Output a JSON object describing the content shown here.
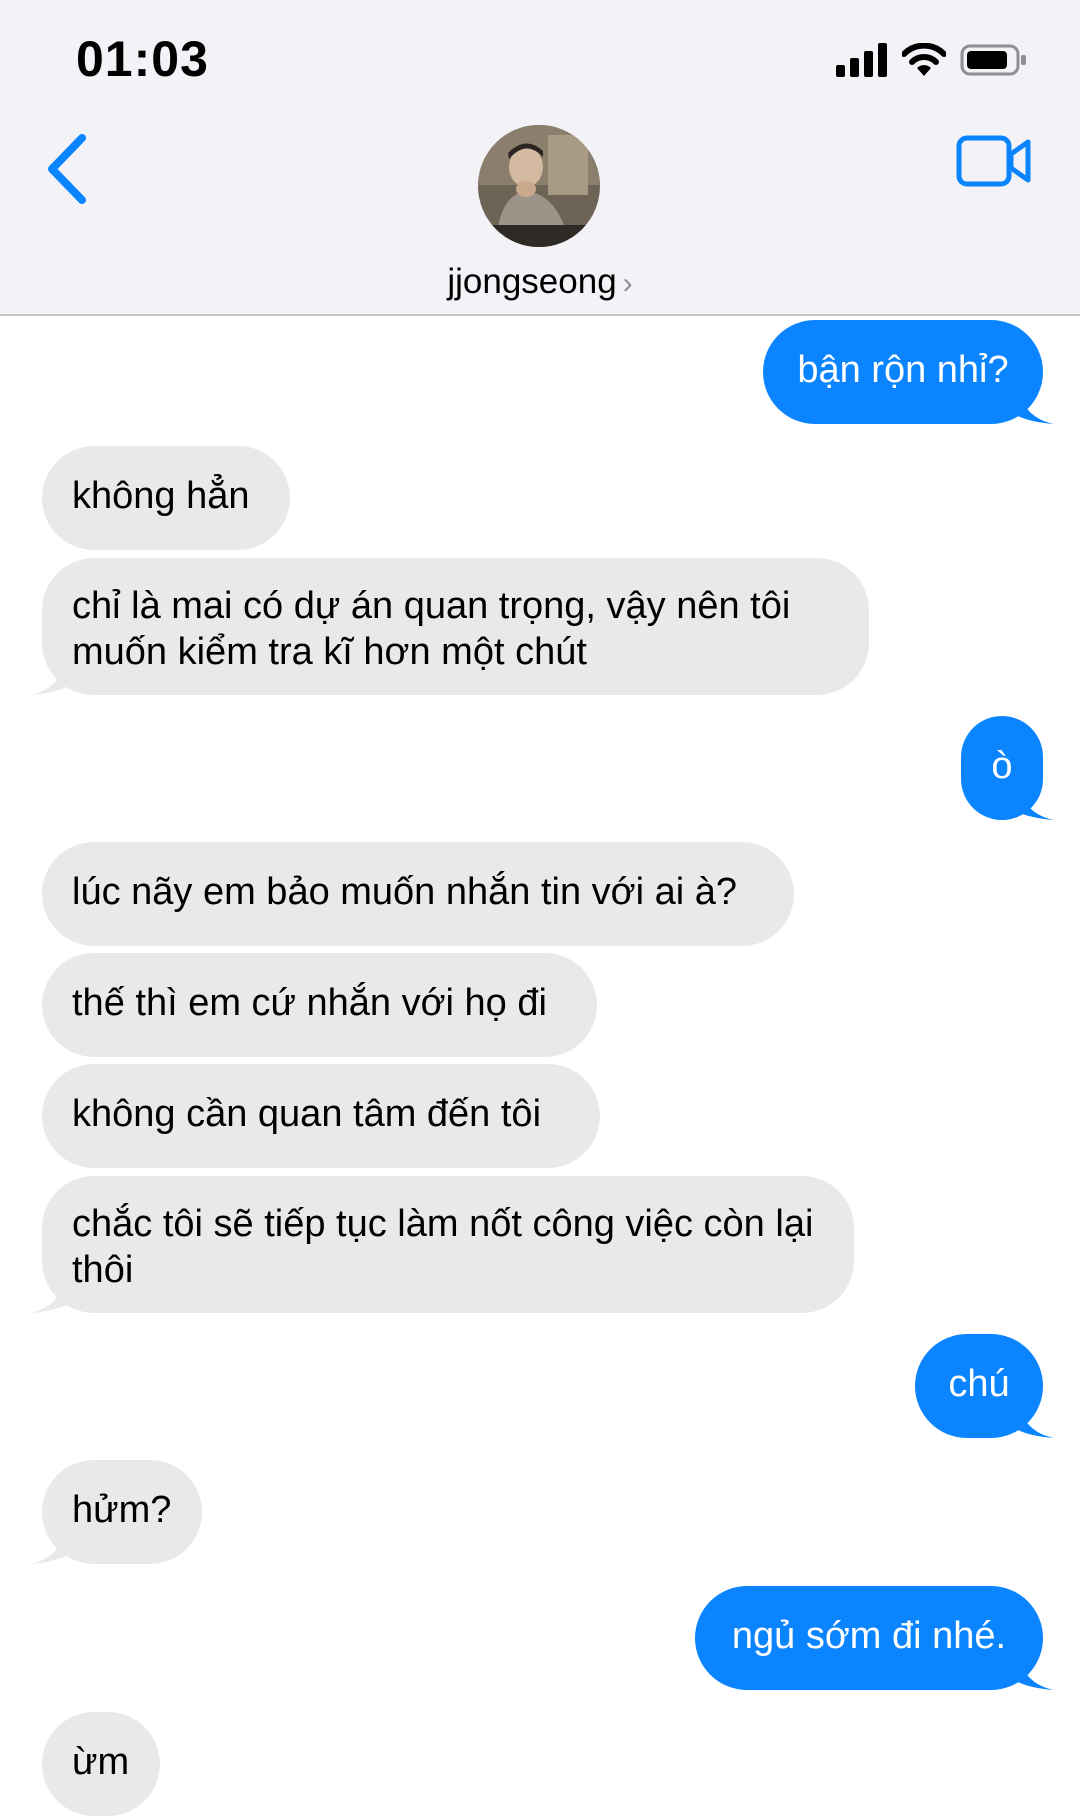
{
  "status_bar": {
    "time": "01:03"
  },
  "header": {
    "contact_name": "jjongseong",
    "chevron": "›",
    "icons": {
      "back": "chevron-left-icon",
      "video": "video-camera-icon"
    }
  },
  "colors": {
    "sent_bubble": "#0a84ff",
    "received_bubble": "#e9e9eb",
    "accent": "#0a84ff"
  },
  "messages": [
    {
      "from": "me",
      "text": "bận rộn nhỉ?"
    },
    {
      "from": "them",
      "text": "không hẳn"
    },
    {
      "from": "them",
      "text": "chỉ là mai có dự án quan trọng, vậy nên tôi muốn kiểm tra kĩ hơn một chút"
    },
    {
      "from": "me",
      "text": "ò"
    },
    {
      "from": "them",
      "text": "lúc nãy em bảo muốn nhắn tin với ai à?"
    },
    {
      "from": "them",
      "text": "thế thì em cứ nhắn với họ đi"
    },
    {
      "from": "them",
      "text": "không cần quan tâm đến tôi"
    },
    {
      "from": "them",
      "text": "chắc tôi sẽ tiếp tục làm nốt công việc còn lại thôi"
    },
    {
      "from": "me",
      "text": "chú"
    },
    {
      "from": "them",
      "text": "hửm?"
    },
    {
      "from": "me",
      "text": "ngủ sớm đi nhé."
    },
    {
      "from": "them",
      "text": "ừm"
    }
  ]
}
